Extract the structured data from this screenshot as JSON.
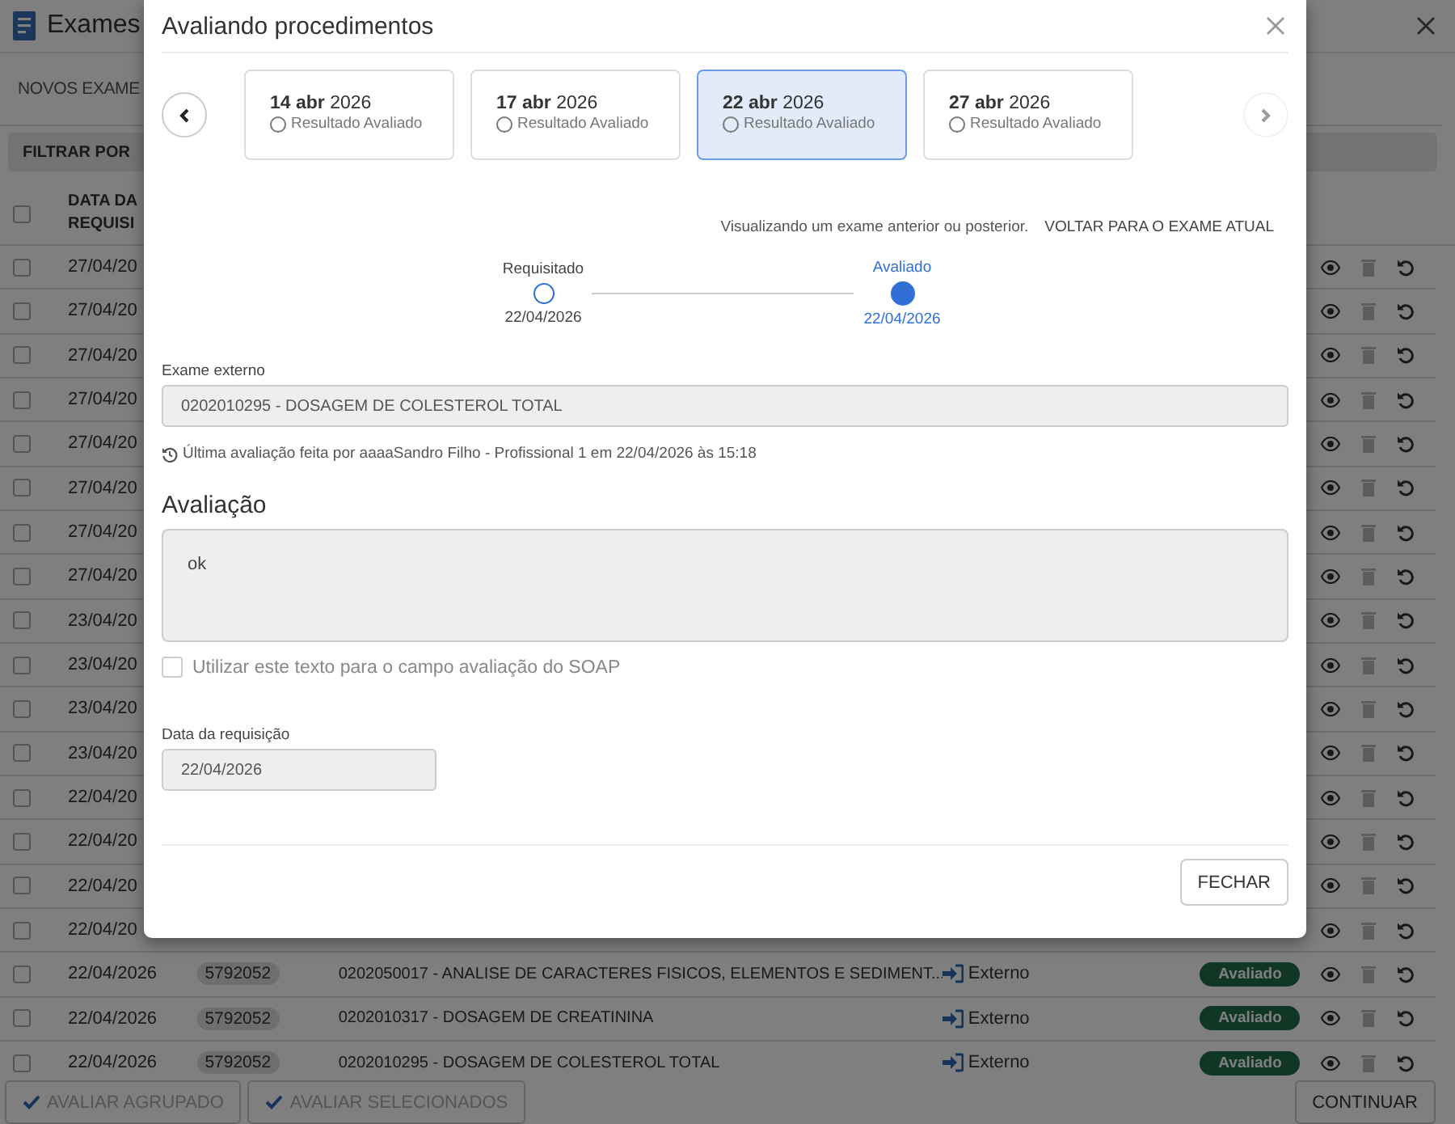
{
  "page": {
    "title": "Exames",
    "tab": "NOVOS EXAME",
    "filter_label": "FILTRAR POR",
    "header_checked": false,
    "date_column": "DATA DA REQUISI",
    "rows": [
      {
        "checked": false,
        "date": "27/04/20"
      },
      {
        "checked": false,
        "date": "27/04/20"
      },
      {
        "checked": false,
        "date": "27/04/20"
      },
      {
        "checked": false,
        "date": "27/04/20"
      },
      {
        "checked": false,
        "date": "27/04/20"
      },
      {
        "checked": false,
        "date": "27/04/20"
      },
      {
        "checked": false,
        "date": "27/04/20"
      },
      {
        "checked": false,
        "date": "27/04/20"
      },
      {
        "checked": false,
        "date": "23/04/20"
      },
      {
        "checked": false,
        "date": "23/04/20"
      },
      {
        "checked": false,
        "date": "23/04/20"
      },
      {
        "checked": false,
        "date": "23/04/20"
      },
      {
        "checked": false,
        "date": "22/04/20"
      },
      {
        "checked": false,
        "date": "22/04/20"
      },
      {
        "checked": false,
        "date": "22/04/20"
      },
      {
        "checked": false,
        "date": "22/04/20"
      },
      {
        "checked": false,
        "date": "22/04/2026",
        "code": "5792052",
        "description": "0202050017 - ANALISE DE CARACTERES FISICOS, ELEMENTOS E SEDIMENT...",
        "origin": "Externo",
        "status": "Avaliado"
      },
      {
        "checked": false,
        "date": "22/04/2026",
        "code": "5792052",
        "description": "0202010317 - DOSAGEM DE CREATININA",
        "origin": "Externo",
        "status": "Avaliado"
      },
      {
        "checked": false,
        "date": "22/04/2026",
        "code": "5792052",
        "description": "0202010295 - DOSAGEM DE COLESTEROL TOTAL",
        "origin": "Externo",
        "status": "Avaliado"
      }
    ],
    "footer_buttons": [
      {
        "label": "AVALIAR AGRUPADO",
        "disabled": true
      },
      {
        "label": "AVALIAR SELECIONADOS",
        "disabled": true
      }
    ],
    "continue_button": "CONTINUAR"
  },
  "modal": {
    "title": "Avaliando procedimentos",
    "prev_disabled": false,
    "next_disabled": true,
    "cards": [
      {
        "date": "**14 abr** 2026",
        "status": "Resultado Avaliado",
        "selected": false
      },
      {
        "date": "**17 abr** 2026",
        "status": "Resultado Avaliado",
        "selected": false
      },
      {
        "date": "**22 abr** 2026",
        "status": "Resultado Avaliado",
        "selected": true
      },
      {
        "date": "**27 abr** 2026",
        "status": "Resultado Avaliado",
        "selected": false
      }
    ],
    "notice": "Visualizando um exame anterior ou posterior.",
    "notice_link": "VOLTAR PARA O EXAME ATUAL",
    "steps": [
      {
        "label": "Requisitado",
        "date": "22/04/2026",
        "active": false
      },
      {
        "label": "Avaliado",
        "date": "22/04/2026",
        "active": true
      }
    ],
    "exam_label": "Exame externo",
    "exam_value": "0202010295 - DOSAGEM DE COLESTEROL TOTAL",
    "history": "Última avaliação feita por aaaaSandro Filho - Profissional 1 em 22/04/2026 às 15:18",
    "evaluation_heading": "Avaliação",
    "evaluation_text": "ok",
    "soap_checkbox": {
      "label": "Utilizar este texto para o campo avaliação do SOAP",
      "checked": false
    },
    "date_label": "Data da requisição",
    "date_value": "22/04/2026",
    "close_button": "FECHAR"
  }
}
